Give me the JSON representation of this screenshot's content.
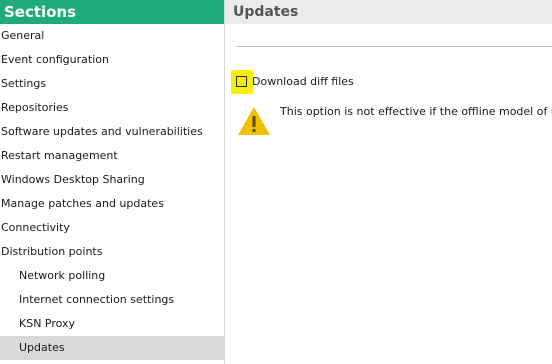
{
  "sidebar": {
    "title": "Sections",
    "items": [
      {
        "label": "General"
      },
      {
        "label": "Event configuration"
      },
      {
        "label": "Settings"
      },
      {
        "label": "Repositories"
      },
      {
        "label": "Software updates and vulnerabilities"
      },
      {
        "label": "Restart management"
      },
      {
        "label": "Windows Desktop Sharing"
      },
      {
        "label": "Manage patches and updates"
      },
      {
        "label": "Connectivity"
      },
      {
        "label": "Distribution points"
      },
      {
        "label": "Network polling"
      },
      {
        "label": "Internet connection settings"
      },
      {
        "label": "KSN Proxy"
      },
      {
        "label": "Updates"
      }
    ]
  },
  "main": {
    "title": "Updates",
    "checkbox_label": "Download diff files",
    "warning_text": "This option is not effective if the offline model of update"
  },
  "colors": {
    "accent": "#1faa7e",
    "highlight": "#f7f100",
    "warning": "#f0c000",
    "selected_bg": "#d9d9d9"
  }
}
